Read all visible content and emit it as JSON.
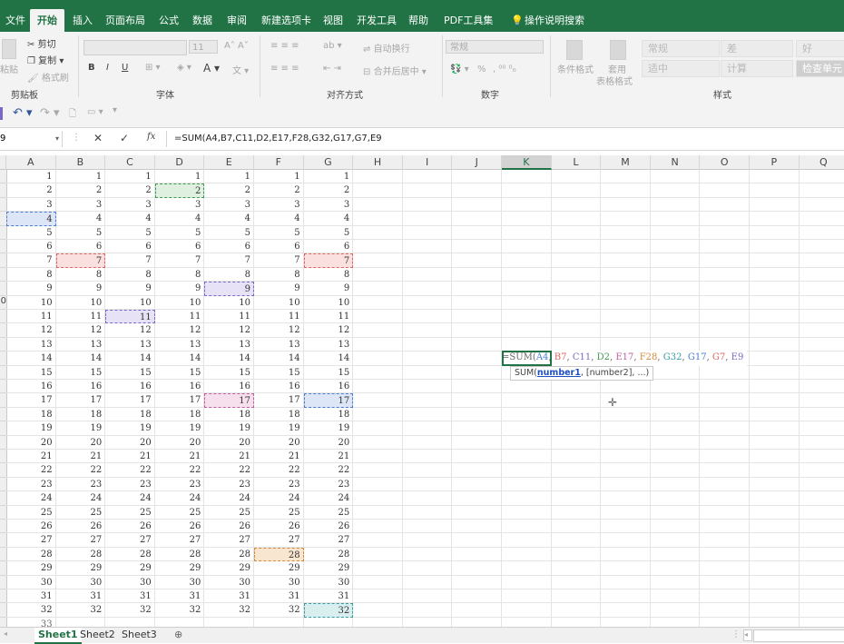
{
  "ribbon_tabs": [
    "文件",
    "开始",
    "插入",
    "页面布局",
    "公式",
    "数据",
    "审阅",
    "新建选项卡",
    "视图",
    "开发工具",
    "帮助",
    "PDF工具集",
    "操作说明搜索"
  ],
  "active_tab_index": 1,
  "clipboard": {
    "paste": "粘贴",
    "cut": "剪切",
    "copy": "复制",
    "format_painter": "格式刷",
    "group": "剪贴板"
  },
  "font": {
    "size": "11",
    "group": "字体"
  },
  "alignment": {
    "wrap": "自动换行",
    "merge": "合并后居中",
    "group": "对齐方式"
  },
  "number": {
    "format": "常规",
    "percent": "%",
    "group": "数字"
  },
  "styles": {
    "conditional": "条件格式",
    "table": "套用",
    "table2": "表格格式",
    "normal": "常规",
    "bad": "差",
    "good": "好",
    "neutral": "适中",
    "calc": "计算",
    "check": "检查单元",
    "group": "样式"
  },
  "formula_bar": {
    "namebox": "9",
    "cancel": "✕",
    "enter": "✓",
    "fx": "fx",
    "formula": "=SUM(A4,B7,C11,D2,E17,F28,G32,G17,G7,E9"
  },
  "columns": [
    "A",
    "B",
    "C",
    "D",
    "E",
    "F",
    "G",
    "H",
    "I",
    "J",
    "K",
    "L",
    "M",
    "N",
    "O",
    "P",
    "Q"
  ],
  "selected_column": "K",
  "row_count": 32,
  "last_row_label": "33",
  "row_header_chars": [
    "",
    "",
    "",
    "",
    "",
    "",
    "",
    "",
    "",
    "0",
    "",
    "",
    "",
    "",
    "",
    "",
    "",
    "",
    "",
    "",
    "",
    "",
    "",
    "",
    "",
    "",
    "",
    "",
    "",
    "",
    "",
    "",
    ""
  ],
  "highlights": [
    {
      "col": "A",
      "row": 4,
      "color": "#4a7fd4",
      "bg": "#dce6f7"
    },
    {
      "col": "B",
      "row": 7,
      "color": "#e06666",
      "bg": "#fbe0e0"
    },
    {
      "col": "C",
      "row": 11,
      "color": "#7b68c8",
      "bg": "#e7e2f6"
    },
    {
      "col": "D",
      "row": 2,
      "color": "#3f9a4f",
      "bg": "#dff0e0"
    },
    {
      "col": "E",
      "row": 17,
      "color": "#c05fa0",
      "bg": "#f6e0ee"
    },
    {
      "col": "F",
      "row": 28,
      "color": "#d48a3b",
      "bg": "#f9e6d0"
    },
    {
      "col": "G",
      "row": 32,
      "color": "#3a9a9f",
      "bg": "#d9eeef"
    },
    {
      "col": "G",
      "row": 17,
      "color": "#4a7fd4",
      "bg": "#dce6f7"
    },
    {
      "col": "G",
      "row": 7,
      "color": "#e06666",
      "bg": "#fbe0e0"
    },
    {
      "col": "E",
      "row": 9,
      "color": "#7b68c8",
      "bg": "#e7e2f6"
    }
  ],
  "formula_cell": {
    "parts": [
      {
        "t": "=SUM(",
        "c": "#666"
      },
      {
        "t": "A4",
        "c": "#4a7fd4"
      },
      {
        "t": ", ",
        "c": "#666"
      },
      {
        "t": "B7",
        "c": "#e06666"
      },
      {
        "t": ", ",
        "c": "#666"
      },
      {
        "t": "C11",
        "c": "#7b68c8"
      },
      {
        "t": ", ",
        "c": "#666"
      },
      {
        "t": "D2",
        "c": "#3f9a4f"
      },
      {
        "t": ", ",
        "c": "#666"
      },
      {
        "t": "E17",
        "c": "#c05fa0"
      },
      {
        "t": ", ",
        "c": "#666"
      },
      {
        "t": "F28",
        "c": "#d48a3b"
      },
      {
        "t": ", ",
        "c": "#666"
      },
      {
        "t": "G32",
        "c": "#3a9a9f"
      },
      {
        "t": ", ",
        "c": "#666"
      },
      {
        "t": "G17",
        "c": "#4a7fd4"
      },
      {
        "t": ", ",
        "c": "#666"
      },
      {
        "t": "G7",
        "c": "#e06666"
      },
      {
        "t": ", ",
        "c": "#666"
      },
      {
        "t": "E9",
        "c": "#7b68c8"
      }
    ],
    "tooltip_fn": "SUM(",
    "tooltip_arg1": "number1",
    "tooltip_rest": ", [number2], ...)"
  },
  "sheets": [
    "Sheet1",
    "Sheet2",
    "Sheet3"
  ],
  "active_sheet": "Sheet1",
  "add_sheet": "⊕"
}
